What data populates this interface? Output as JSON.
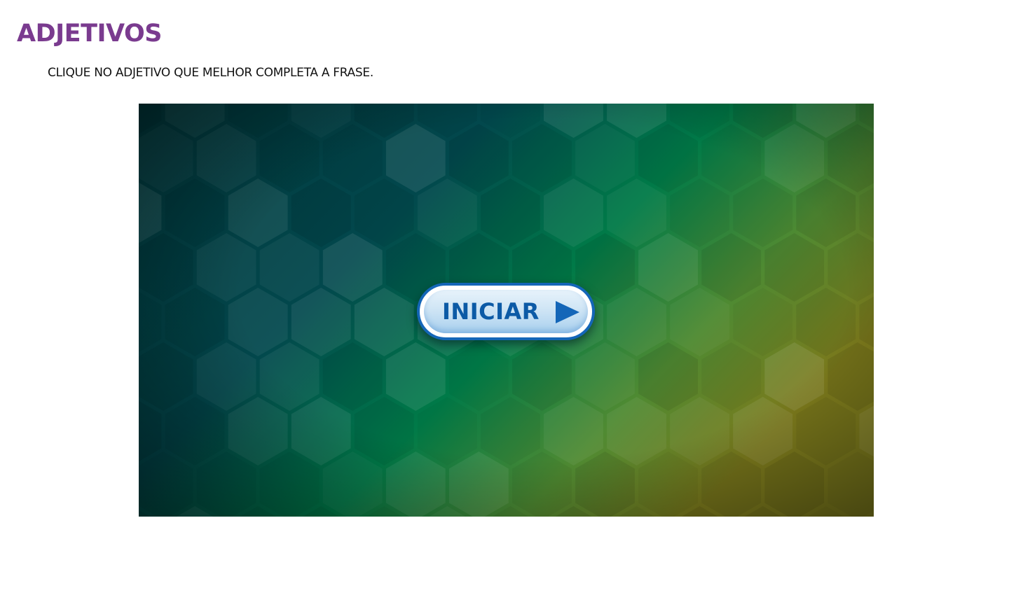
{
  "page": {
    "title": "ADJETIVOS",
    "instruction": "CLIQUE NO ADJETIVO QUE MELHOR COMPLETA A FRASE."
  },
  "game": {
    "start_button_label": "INICIAR",
    "start_button_icon": "play-triangle-icon",
    "background_style": "hexagon-pattern",
    "colors": {
      "title": "#7a3b8f",
      "button_border": "#1466b8",
      "button_text": "#0c5aa6",
      "bg_dark_teal": "#023c3f",
      "bg_green": "#008a4a",
      "bg_olive": "#8a8a20"
    }
  }
}
